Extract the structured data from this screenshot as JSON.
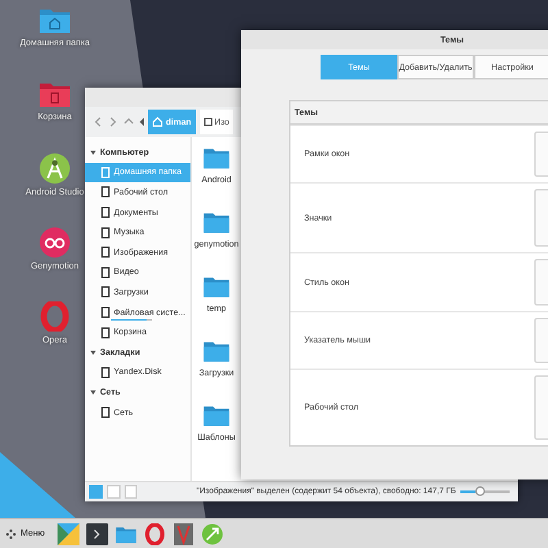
{
  "desktop_icons": [
    {
      "label": "Домашняя папка",
      "kind": "home"
    },
    {
      "label": "Корзина",
      "kind": "trash"
    },
    {
      "label": "Android Studio",
      "kind": "android"
    },
    {
      "label": "Genymotion",
      "kind": "genymotion"
    },
    {
      "label": "Opera",
      "kind": "opera"
    }
  ],
  "file_manager": {
    "breadcrumbs": [
      {
        "label": "diman",
        "selected": true
      },
      {
        "label": "Изо",
        "selected": false
      }
    ],
    "sidebar": [
      {
        "label": "Компьютер",
        "expanded": true,
        "children": [
          {
            "label": "Домашняя папка",
            "selected": true
          },
          {
            "label": "Рабочий стол",
            "selected": false
          },
          {
            "label": "Документы",
            "selected": false
          },
          {
            "label": "Музыка",
            "selected": false
          },
          {
            "label": "Изображения",
            "selected": false
          },
          {
            "label": "Видео",
            "selected": false
          },
          {
            "label": "Загрузки",
            "selected": false
          },
          {
            "label": "Файловая систе...",
            "selected": false,
            "level": 0.85
          },
          {
            "label": "Корзина",
            "selected": false
          }
        ]
      },
      {
        "label": "Закладки",
        "expanded": true,
        "children": [
          {
            "label": "Yandex.Disk",
            "selected": false
          }
        ]
      },
      {
        "label": "Сеть",
        "expanded": true,
        "children": [
          {
            "label": "Сеть",
            "selected": false
          }
        ]
      }
    ],
    "files": [
      {
        "name": "Android"
      },
      {
        "name": "genymotion"
      },
      {
        "name": "temp"
      },
      {
        "name": "Загрузки"
      },
      {
        "name": "Шаблоны"
      }
    ],
    "status": "\"Изображения\" выделен (содержит 54 объекта), свободно: 147,7 ГБ",
    "zoom": {
      "level": 0.3
    }
  },
  "themes_window": {
    "title": "Темы",
    "tabs": [
      {
        "label": "Темы",
        "selected": true
      },
      {
        "label": "Добавить/Удалить",
        "selected": false
      },
      {
        "label": "Настройки",
        "selected": false
      }
    ],
    "table": {
      "header": "Темы",
      "rows": [
        "Рамки окон",
        "Значки",
        "Стиль окон",
        "Указатель мыши",
        "Рабочий стол"
      ]
    }
  },
  "taskbar": {
    "menu_label": "Меню",
    "apps": [
      {
        "kind": "plasma"
      },
      {
        "kind": "terminal"
      },
      {
        "kind": "folder"
      },
      {
        "kind": "opera"
      },
      {
        "kind": "viewer"
      },
      {
        "kind": "green"
      }
    ]
  }
}
